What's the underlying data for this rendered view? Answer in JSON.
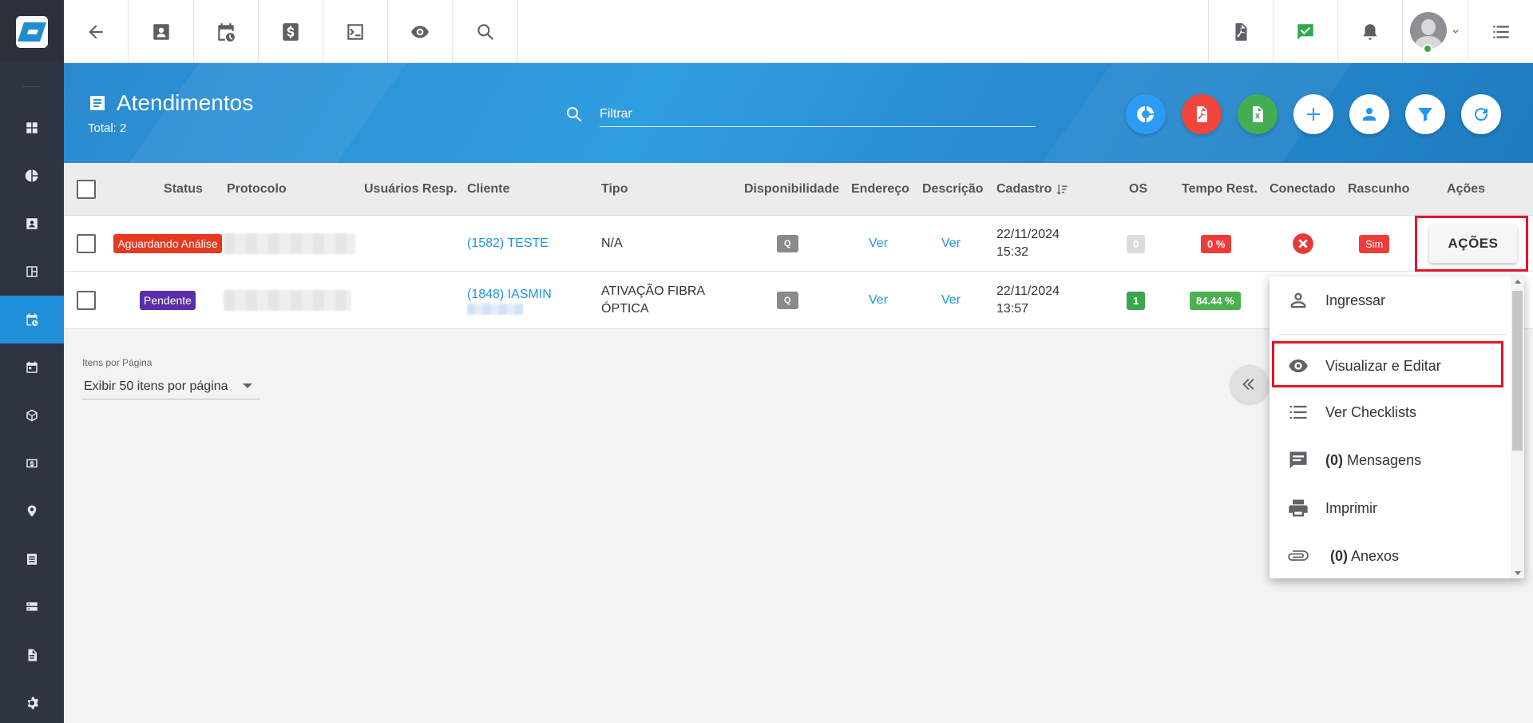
{
  "topbar": {
    "icons": [
      "back-arrow-icon",
      "contact-card-icon",
      "calendar-clock-icon",
      "dollar-icon",
      "terminal-icon",
      "eye-icon",
      "search-icon",
      "pdf-icon",
      "chat-check-icon",
      "bell-icon",
      "user-avatar",
      "list-icon"
    ]
  },
  "header": {
    "title": "Atendimentos",
    "total": "Total: 2",
    "filter_placeholder": "Filtrar",
    "actions": [
      "chart-donut-icon",
      "pdf-export-icon",
      "excel-export-icon",
      "add-icon",
      "user-icon",
      "filter-icon",
      "refresh-icon"
    ]
  },
  "table": {
    "columns": [
      "Status",
      "Protocolo",
      "Usuários Resp.",
      "Cliente",
      "Tipo",
      "Disponibilidade",
      "Endereço",
      "Descrição",
      "Cadastro",
      "OS",
      "Tempo Rest.",
      "Conectado",
      "Rascunho",
      "Ações"
    ],
    "rows": [
      {
        "status": "Aguardando Análise",
        "status_color": "#e53a21",
        "cliente": "(1582) TESTE",
        "cliente_extra": "",
        "tipo_line1": "N/A",
        "tipo_line2": "",
        "disponibilidade": "Q",
        "endereco": "Ver",
        "descricao": "Ver",
        "cadastro_date": "22/11/2024",
        "cadastro_time": "15:32",
        "os": "0",
        "os_color": "#dcdcdc",
        "tempo": "0 %",
        "tempo_color": "#f03b3b",
        "conectado": "error",
        "rascunho": "Sim"
      },
      {
        "status": "Pendente",
        "status_color": "#5a2ea6",
        "cliente": "(1848) IASMIN",
        "cliente_extra": "",
        "tipo_line1": "ATIVAÇÃO FIBRA",
        "tipo_line2": "ÓPTICA",
        "disponibilidade": "Q",
        "endereco": "Ver",
        "descricao": "Ver",
        "cadastro_date": "22/11/2024",
        "cadastro_time": "13:57",
        "os": "1",
        "os_color": "#3aa84a",
        "tempo": "84.44 %",
        "tempo_color": "#4caf50"
      }
    ]
  },
  "pagination": {
    "label": "Itens por Página",
    "selected": "Exibir 50 itens por página"
  },
  "acoes_button": "AÇÕES",
  "menu": {
    "items": [
      {
        "label": "Ingressar",
        "icon": "person-icon"
      },
      {
        "label": "Visualizar e Editar",
        "icon": "eye-icon"
      },
      {
        "label": "Ver Checklists",
        "icon": "checklist-icon"
      },
      {
        "count": "(0)",
        "label": "Mensagens",
        "icon": "message-icon"
      },
      {
        "label": "Imprimir",
        "icon": "printer-icon"
      },
      {
        "count": "(0)",
        "label": "Anexos",
        "icon": "paperclip-icon"
      }
    ]
  }
}
